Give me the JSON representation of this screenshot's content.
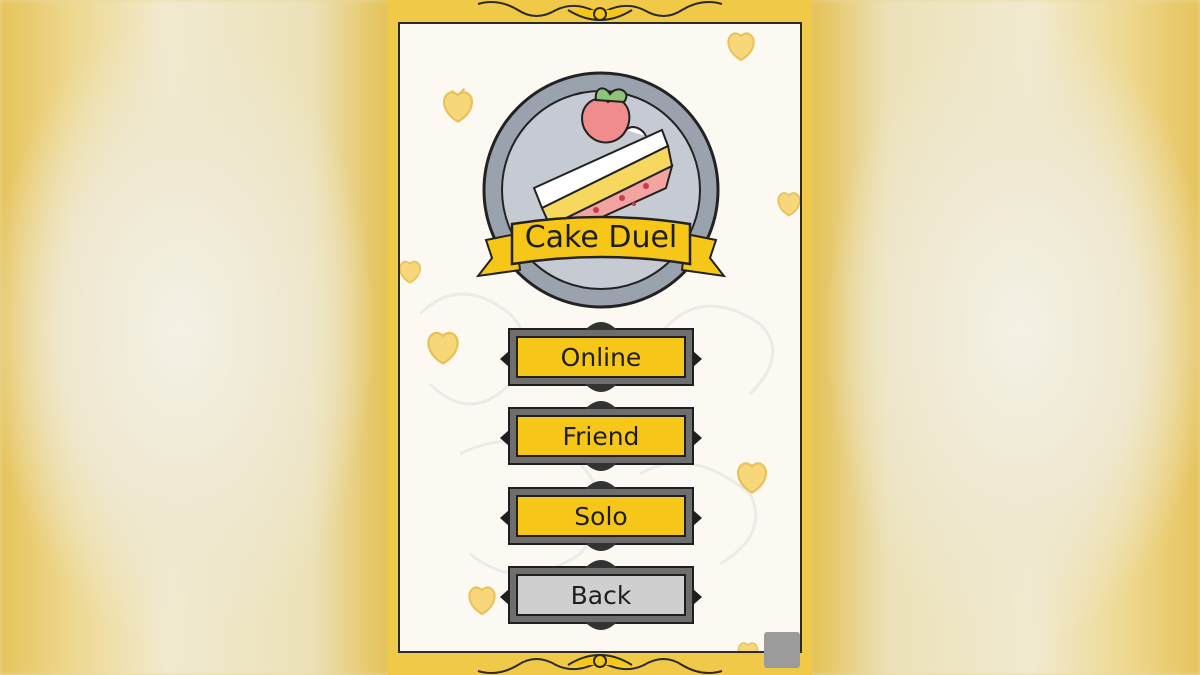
{
  "game": {
    "title": "Cake Duel"
  },
  "menu": {
    "online_label": "Online",
    "friend_label": "Friend",
    "solo_label": "Solo",
    "back_label": "Back"
  },
  "colors": {
    "accent_yellow": "#f6c718",
    "frame_gold": "#f0c948",
    "button_grey": "#cfcfcf",
    "button_frame": "#6e6e6e",
    "outline": "#1f1f1f"
  },
  "icons": {
    "logo": "cake-slice-plate-icon",
    "decor": "strawberry-leaf-icon",
    "badge": "app-badge-icon"
  }
}
